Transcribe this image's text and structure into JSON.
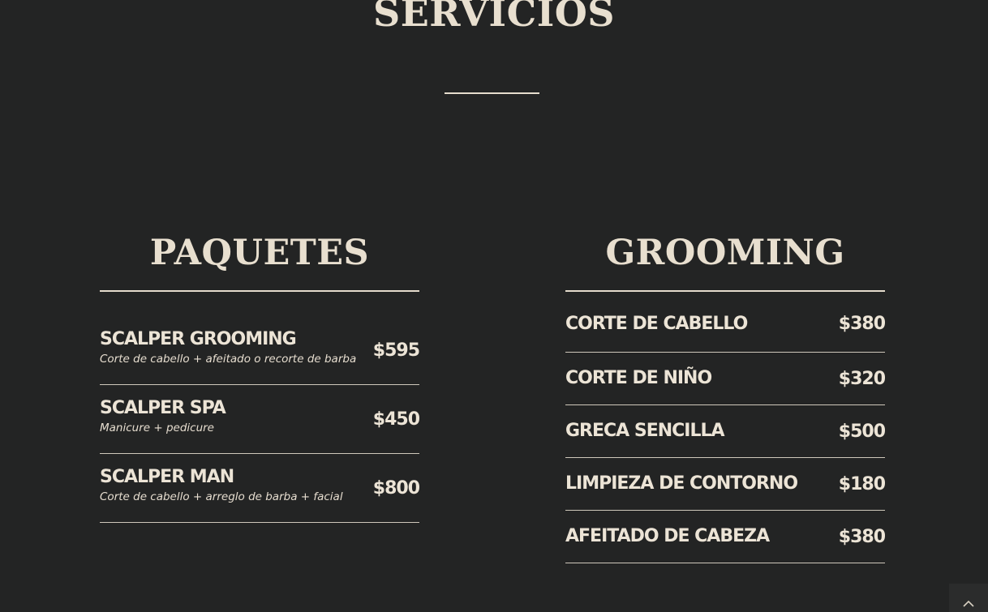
{
  "page": {
    "heading": "SERVICIOS"
  },
  "paquetes": {
    "title": "PAQUETES",
    "items": [
      {
        "name": "SCALPER GROOMING",
        "description": "Corte de cabello + afeitado o recorte de barba",
        "price": "$595"
      },
      {
        "name": "SCALPER SPA",
        "description": "Manicure + pedicure",
        "price": "$450"
      },
      {
        "name": "SCALPER MAN",
        "description": "Corte de cabello + arreglo de barba + facial",
        "price": "$800"
      }
    ]
  },
  "grooming": {
    "title": "GROOMING",
    "items": [
      {
        "name": "CORTE DE CABELLO",
        "price": "$380"
      },
      {
        "name": "CORTE DE NIÑO",
        "price": "$320"
      },
      {
        "name": "GRECA SENCILLA",
        "price": "$500"
      },
      {
        "name": "LIMPIEZA DE CONTORNO",
        "price": "$180"
      },
      {
        "name": "AFEITADO DE CABEZA",
        "price": "$380"
      }
    ]
  },
  "scroll_top": {
    "icon": "chevron-up-icon"
  }
}
